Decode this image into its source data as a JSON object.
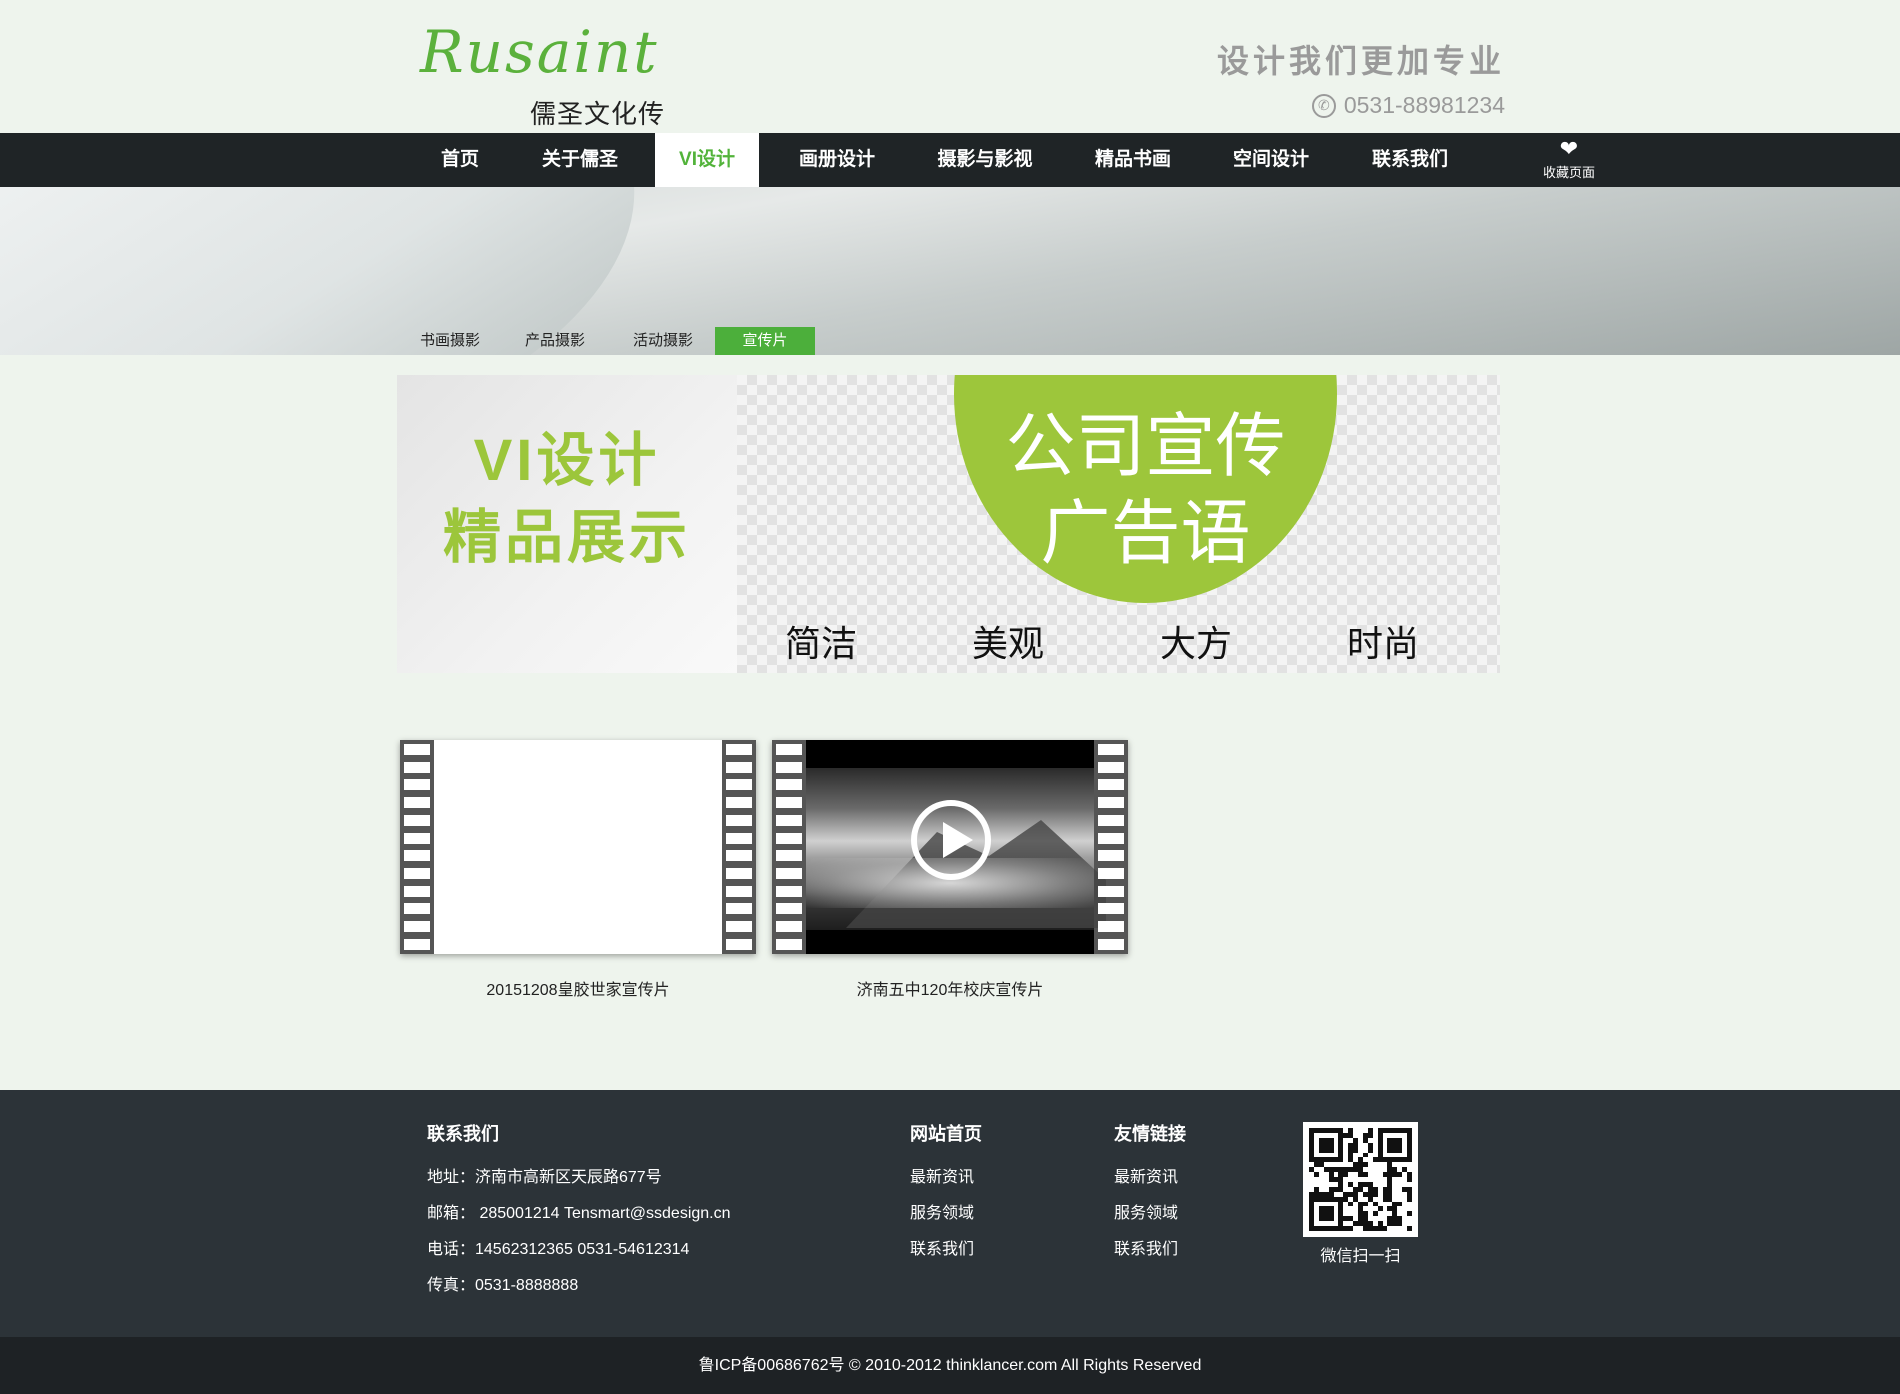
{
  "header": {
    "logo_script": "Rusaint",
    "logo_cn": "儒圣文化传媒",
    "slogan": "设计我们更加专业",
    "phone": "0531-88981234",
    "phone_icon": "phone-icon"
  },
  "nav": {
    "items": [
      {
        "label": "首页"
      },
      {
        "label": "关于儒圣"
      },
      {
        "label": "VI设计"
      },
      {
        "label": "画册设计"
      },
      {
        "label": "摄影与影视"
      },
      {
        "label": "精品书画"
      },
      {
        "label": "空间设计"
      },
      {
        "label": "联系我们"
      }
    ],
    "active_index": 2,
    "favorite_label": "收藏页面",
    "favorite_icon": "heart-icon"
  },
  "banner": {
    "subtabs": [
      {
        "label": "书画摄影"
      },
      {
        "label": "产品摄影"
      },
      {
        "label": "活动摄影"
      },
      {
        "label": "宣传片"
      }
    ],
    "active_subtab": 3
  },
  "promo": {
    "left_line1": "VI设计",
    "left_line2": "精品展示",
    "circle_line1": "公司宣传",
    "circle_line2": "广告语",
    "words": [
      "简洁",
      "美观",
      "大方",
      "时尚"
    ]
  },
  "videos": [
    {
      "caption": "20151208皇胶世家宣传片"
    },
    {
      "caption": "济南五中120年校庆宣传片"
    }
  ],
  "footer": {
    "contact": {
      "title": "联系我们",
      "address": "地址：济南市高新区天辰路677号",
      "email": "邮箱： 285001214 Tensmart@ssdesign.cn",
      "phone": "电话：14562312365    0531-54612314",
      "fax": "传真：0531-8888888"
    },
    "site_links": {
      "title": "网站首页",
      "items": [
        "最新资讯",
        "服务领域",
        "联系我们"
      ]
    },
    "friend_links": {
      "title": "友情链接",
      "items": [
        "最新资讯",
        "服务领域",
        "联系我们"
      ]
    },
    "qr_label": "微信扫一扫"
  },
  "copyright": "鲁ICP备00686762号 © 2010-2012 thinklancer.com All Rights Reserved",
  "colors": {
    "accent_green": "#52b33a",
    "promo_green": "#9dc63b",
    "nav_bg": "#1f2426",
    "footer_bg": "#2c3338"
  }
}
